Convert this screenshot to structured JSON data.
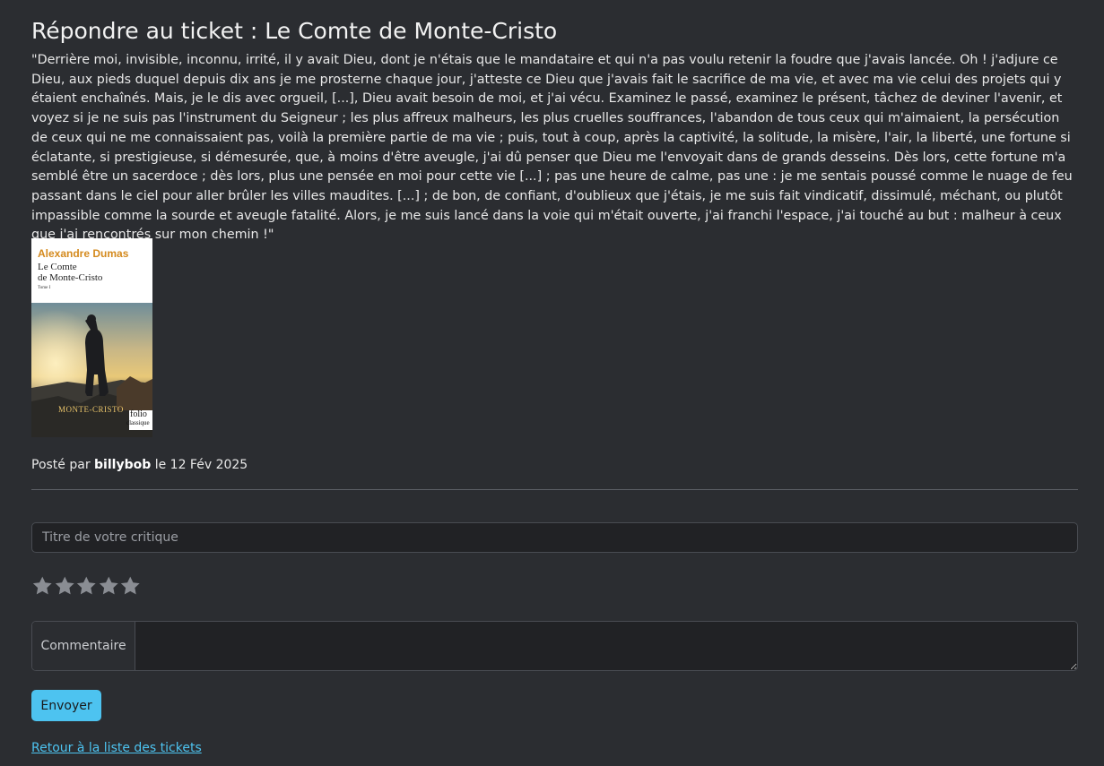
{
  "page": {
    "title": "Répondre au ticket : Le Comte de Monte-Cristo",
    "description": "\"Derrière moi, invisible, inconnu, irrité, il y avait Dieu, dont je n'étais que le mandataire et qui n'a pas voulu retenir la foudre que j'avais lancée. Oh ! j'adjure ce Dieu, aux pieds duquel depuis dix ans je me prosterne chaque jour, j'atteste ce Dieu que j'avais fait le sacrifice de ma vie, et avec ma vie celui des projets qui y étaient enchaînés. Mais, je le dis avec orgueil, [...], Dieu avait besoin de moi, et j'ai vécu. Examinez le passé, examinez le présent, tâchez de deviner l'avenir, et voyez si je ne suis pas l'instrument du Seigneur ; les plus affreux malheurs, les plus cruelles souffrances, l'abandon de tous ceux qui m'aimaient, la persécution de ceux qui ne me connaissaient pas, voilà la première partie de ma vie ; puis, tout à coup, après la captivité, la solitude, la misère, l'air, la liberté, une fortune si éclatante, si prestigieuse, si démesurée, que, à moins d'être aveugle, j'ai dû penser que Dieu me l'envoyait dans de grands desseins. Dès lors, cette fortune m'a semblé être un sacerdoce ; dès lors, plus une pensée en moi pour cette vie [...] ; pas une heure de calme, pas une : je me sentais poussé comme le nuage de feu passant dans le ciel pour aller brûler les villes maudites. [...] ; de bon, de confiant, d'oublieux que j'étais, je me suis fait vindicatif, dissimulé, méchant, ou plutôt impassible comme la sourde et aveugle fatalité. Alors, je me suis lancé dans la voie qui m'était ouverte, j'ai franchi l'espace, j'ai touché au but : malheur à ceux que j'ai rencontrés sur mon chemin !\""
  },
  "cover": {
    "author": "Alexandre Dumas",
    "title_line1": "Le Comte",
    "title_line2": "de Monte-Cristo",
    "tome": "Tome I",
    "art_title": "MONTE-CRISTO",
    "publisher": "folio",
    "collection": "classique"
  },
  "meta": {
    "posted_by_prefix": "Posté par",
    "author": "billybob",
    "date_prefix": "le",
    "date": "12 Fév 2025"
  },
  "form": {
    "title_placeholder": "Titre de votre critique",
    "title_value": "",
    "rating": 0,
    "rating_max": 5,
    "star_color": "#8a8d93",
    "comment_label": "Commentaire",
    "comment_value": "",
    "submit_label": "Envoyer"
  },
  "nav": {
    "back_link": "Retour à la liste des tickets"
  },
  "colors": {
    "background": "#2b2d31",
    "accent": "#4dc3f0",
    "input_background": "#212225",
    "author_orange": "#d48a1e"
  }
}
